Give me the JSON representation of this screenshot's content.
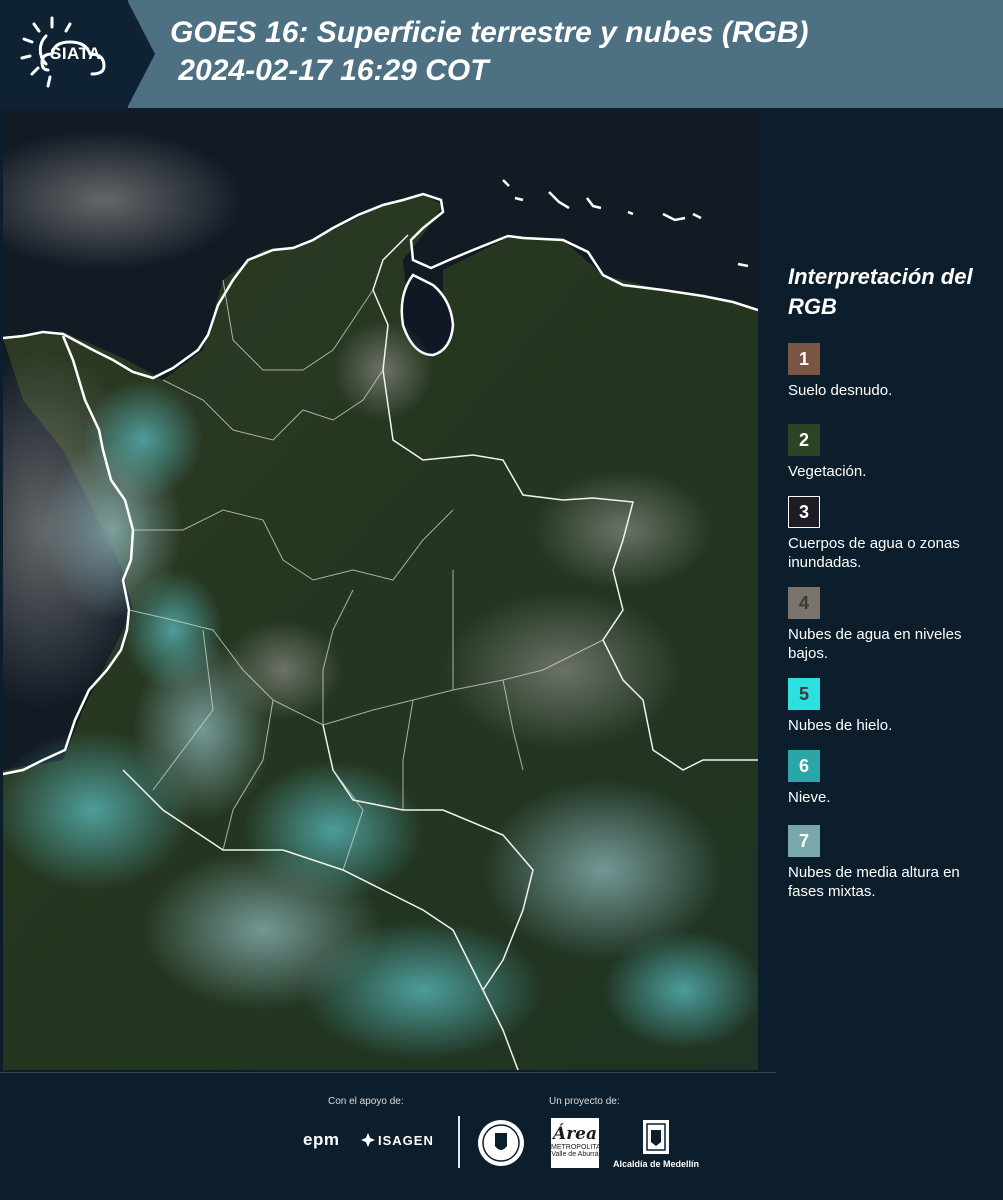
{
  "header": {
    "logo_text": "SIATA",
    "title_line1": "GOES 16: Superficie terrestre y nubes (RGB)",
    "title_line2": " 2024-02-17 16:29 COT"
  },
  "legend": {
    "title": "Interpretación del RGB",
    "items": [
      {
        "number": "1",
        "label": "Suelo desnudo.",
        "color": "#7a5544"
      },
      {
        "number": "2",
        "label": "Vegetación.",
        "color": "#2b4426"
      },
      {
        "number": "3",
        "label": "Cuerpos de agua o zonas inundadas.",
        "color": "#1c1c26"
      },
      {
        "number": "4",
        "label": "Nubes de agua en niveles bajos.",
        "color": "#7a736b"
      },
      {
        "number": "5",
        "label": "Nubes de hielo.",
        "color": "#2ce0e0"
      },
      {
        "number": "6",
        "label": "Nieve.",
        "color": "#2aa5a8"
      },
      {
        "number": "7",
        "label": "Nubes de media altura en fases mixtas.",
        "color": "#7aa8a8"
      }
    ]
  },
  "footer": {
    "support_label": "Con el apoyo de:",
    "project_label": "Un proyecto de:",
    "sponsors": [
      "epm",
      "ISAGEN"
    ],
    "partners": {
      "area_big": "Área",
      "area_small": "METROPOLITANA Valle de Aburrá",
      "alcaldia": "Alcaldía de Medellín"
    }
  }
}
